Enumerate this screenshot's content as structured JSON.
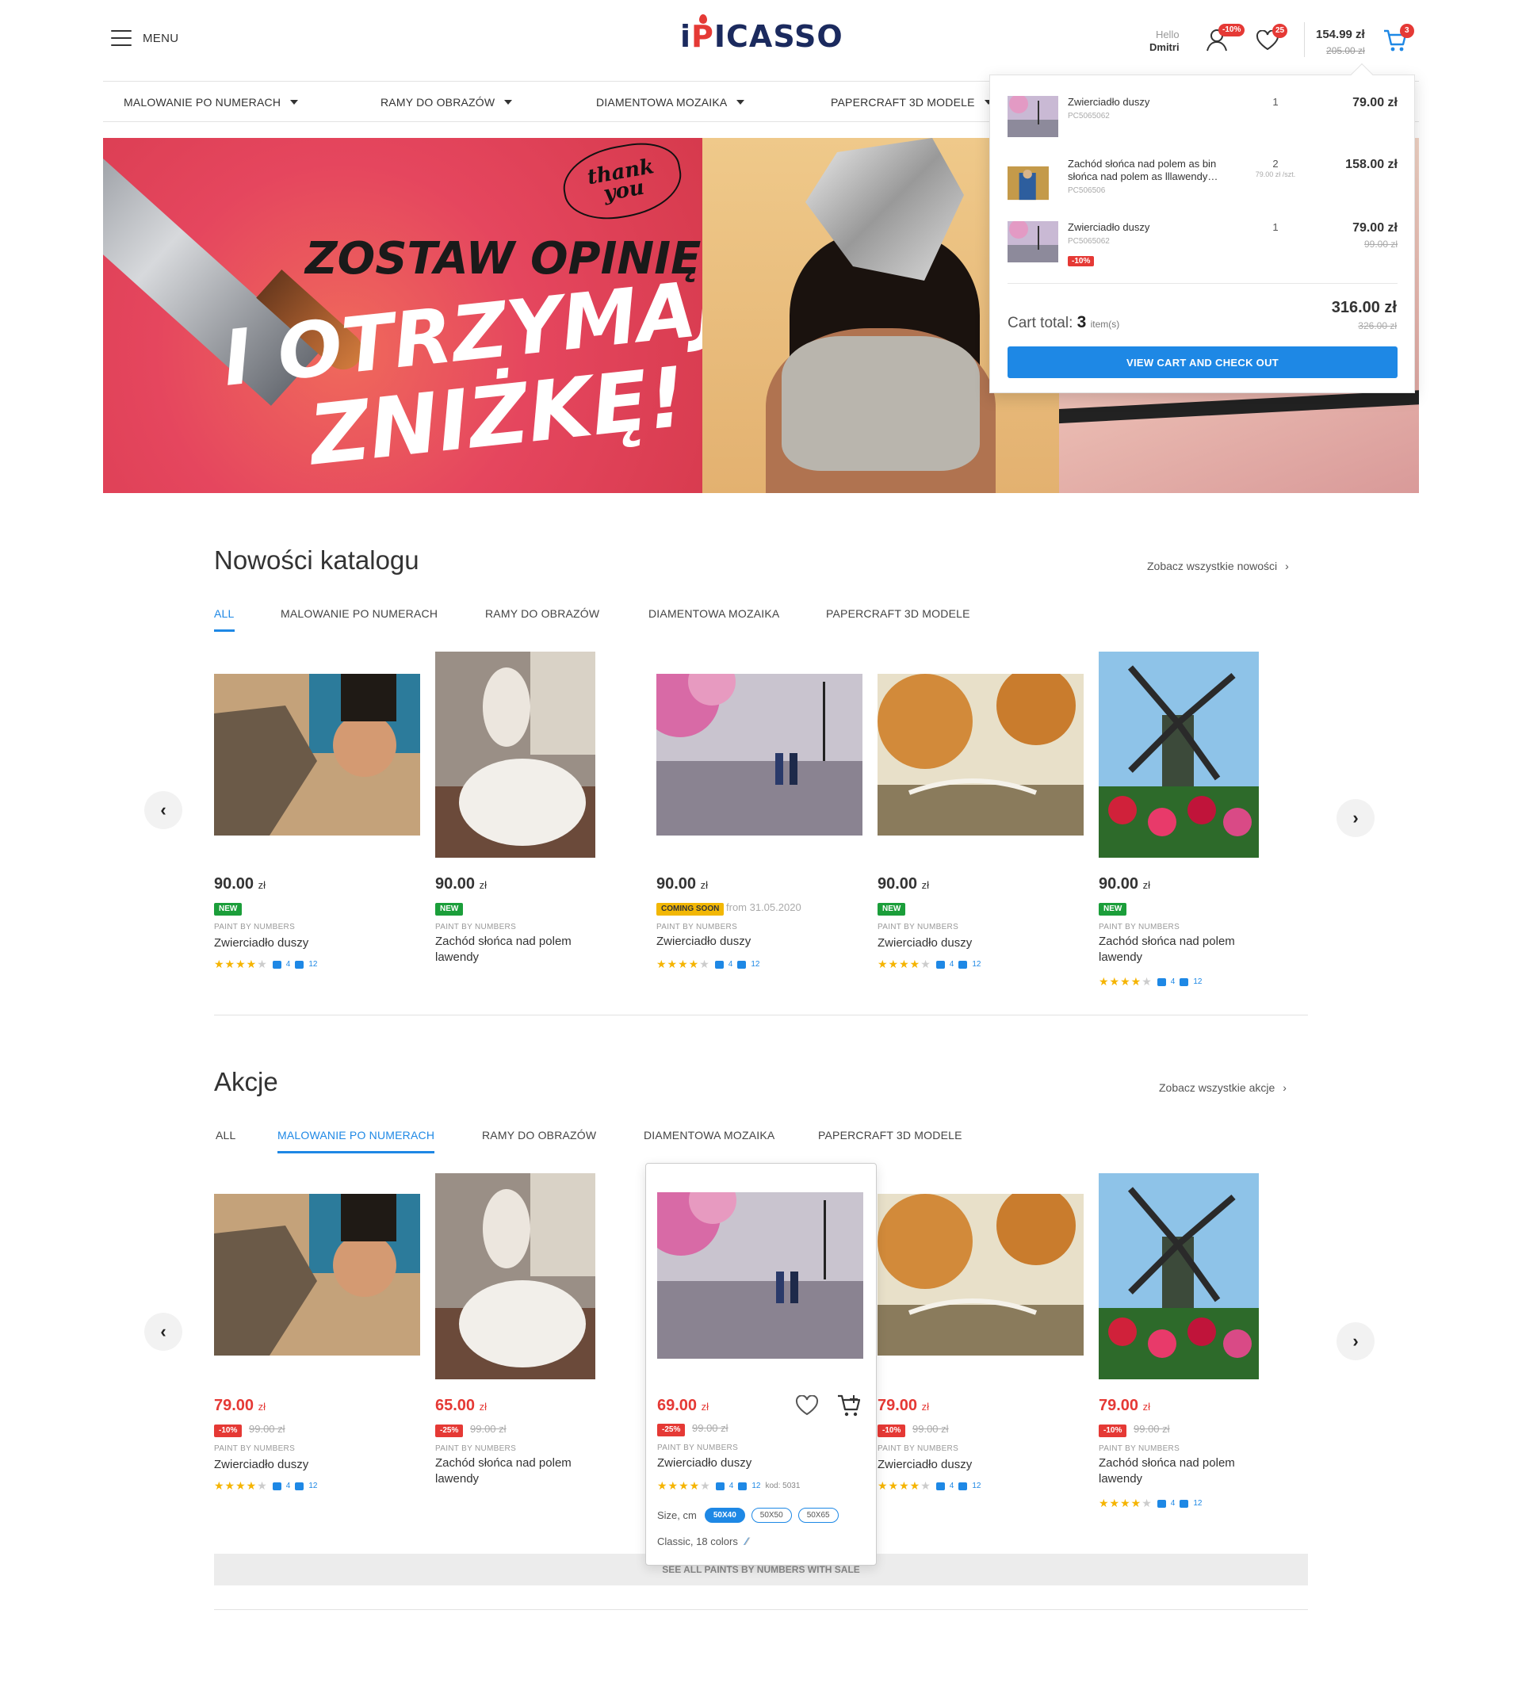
{
  "header": {
    "menu_label": "MENU",
    "logo_left": "i",
    "logo_ired": "P",
    "logo_right": "ICASSO",
    "hello": "Hello",
    "user_name": "Dmitri",
    "user_badge": "-10%",
    "wishlist_count": "25",
    "cart_amount": "154.99 zł",
    "cart_old_amount": "205.00 zł",
    "cart_count": "3"
  },
  "nav": {
    "items": [
      "MALOWANIE PO NUMERACH",
      "RAMY DO OBRAZÓW",
      "DIAMENTOWA MOZAIKA",
      "PAPERCRAFT 3D MODELE"
    ]
  },
  "hero": {
    "line1": "ZOSTAW OPINIĘ",
    "line2": "I OTRZYMAJ",
    "line3": "ZNIŻKĘ!",
    "thank": "thank",
    "you": "you"
  },
  "cart_dropdown": {
    "items": [
      {
        "name": "Zwierciadło duszy",
        "code": "PC5065062",
        "qty": "1",
        "unit": "",
        "price": "79.00 zł",
        "old_price": "",
        "discount": ""
      },
      {
        "name": "Zachód słońca nad polem as bin słońca nad polem as lllawendy…",
        "code": "PC506506",
        "qty": "2",
        "unit": "79.00 zł /szt.",
        "price": "158.00 zł",
        "old_price": "",
        "discount": ""
      },
      {
        "name": "Zwierciadło duszy",
        "code": "PC5065062",
        "qty": "1",
        "unit": "",
        "price": "79.00 zł",
        "old_price": "99.00 zł",
        "discount": "-10%"
      }
    ],
    "total_label": "Cart total:",
    "total_count": "3",
    "total_items_word": "item(s)",
    "total": "316.00 zł",
    "total_old": "326.00 zł",
    "button": "VIEW CART AND CHECK OUT"
  },
  "news": {
    "title": "Nowości katalogu",
    "see_all": "Zobacz wszystkie nowości",
    "tabs": [
      "ALL",
      "MALOWANIE PO NUMERACH",
      "RAMY DO OBRAZÓW",
      "DIAMENTOWA MOZAIKA",
      "PAPERCRAFT 3D MODELE"
    ],
    "products": [
      {
        "price": "90.00",
        "currency": "zł",
        "tag": "NEW",
        "tag_after": "",
        "category": "PAINT BY NUMBERS",
        "name": "Zwierciadło duszy",
        "comments": "4",
        "photos": "12"
      },
      {
        "price": "90.00",
        "currency": "zł",
        "tag": "NEW",
        "tag_after": "",
        "category": "PAINT BY NUMBERS",
        "name": "Zachód słońca nad polem lawendy",
        "comments": "",
        "photos": ""
      },
      {
        "price": "90.00",
        "currency": "zł",
        "tag": "COMING SOON",
        "tag_after": "from 31.05.2020",
        "category": "PAINT BY NUMBERS",
        "name": "Zwierciadło duszy",
        "comments": "4",
        "photos": "12"
      },
      {
        "price": "90.00",
        "currency": "zł",
        "tag": "NEW",
        "tag_after": "",
        "category": "PAINT BY NUMBERS",
        "name": "Zwierciadło duszy",
        "comments": "4",
        "photos": "12"
      },
      {
        "price": "90.00",
        "currency": "zł",
        "tag": "NEW",
        "tag_after": "",
        "category": "PAINT BY NUMBERS",
        "name": "Zachód słońca nad polem lawendy",
        "comments": "4",
        "photos": "12"
      }
    ]
  },
  "sale": {
    "title": "Akcje",
    "see_all": "Zobacz wszystkie akcje",
    "tabs": [
      "ALL",
      "MALOWANIE PO NUMERACH",
      "RAMY DO OBRAZÓW",
      "DIAMENTOWA MOZAIKA",
      "PAPERCRAFT 3D MODELE"
    ],
    "products": [
      {
        "price": "79.00",
        "currency": "zł",
        "discount": "-10%",
        "old": "99.00 zł",
        "category": "PAINT BY NUMBERS",
        "name": "Zwierciadło duszy",
        "comments": "4",
        "photos": "12"
      },
      {
        "price": "65.00",
        "currency": "zł",
        "discount": "-25%",
        "old": "99.00 zł",
        "category": "PAINT BY NUMBERS",
        "name": "Zachód słońca nad polem lawendy",
        "comments": "",
        "photos": ""
      },
      {
        "price": "69.00",
        "currency": "zł",
        "discount": "-25%",
        "old": "99.00 zł",
        "category": "PAINT BY NUMBERS",
        "name": "Zwierciadło duszy",
        "comments": "4",
        "photos": "12",
        "code": "kod: 5031"
      },
      {
        "price": "79.00",
        "currency": "zł",
        "discount": "-10%",
        "old": "99.00 zł",
        "category": "PAINT BY NUMBERS",
        "name": "Zwierciadło duszy",
        "comments": "4",
        "photos": "12"
      },
      {
        "price": "79.00",
        "currency": "zł",
        "discount": "-10%",
        "old": "99.00 zł",
        "category": "PAINT BY NUMBERS",
        "name": "Zachód słońca nad polem lawendy",
        "comments": "4",
        "photos": "12"
      }
    ],
    "size_label": "Size, cm",
    "sizes": [
      "50X40",
      "50X50",
      "50X65"
    ],
    "selected_size": "50X40",
    "colors_label": "Classic, 18 colors",
    "see_bar": "SEE ALL PAINTS BY NUMBERS WITH SALE"
  },
  "colors": {
    "accent": "#1e88e5",
    "sale": "#e53935",
    "new": "#1b9e3a",
    "soon": "#f2b705"
  }
}
